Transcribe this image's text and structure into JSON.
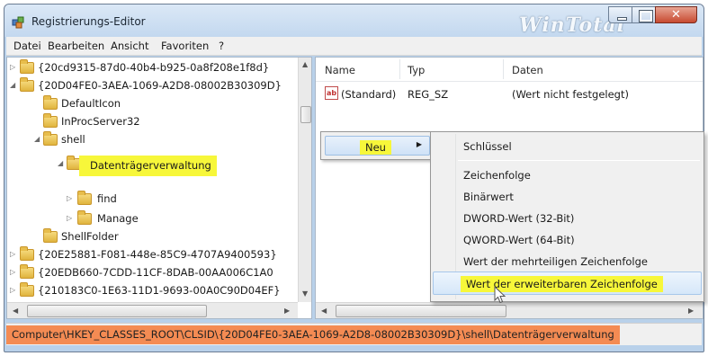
{
  "window": {
    "title": "Registrierungs-Editor",
    "watermark": "WinTotal"
  },
  "menu": [
    "Datei",
    "Bearbeiten",
    "Ansicht",
    "Favoriten",
    "?"
  ],
  "tree": [
    {
      "label": "{20cd9315-87d0-40b4-b925-0a8f208e1f8d}",
      "expander": "▷"
    },
    {
      "label": "{20D04FE0-3AEA-1069-A2D8-08002B30309D}",
      "expander": "◢"
    },
    {
      "label": "DefaultIcon",
      "expander": ""
    },
    {
      "label": "InProcServer32",
      "expander": ""
    },
    {
      "label": "shell",
      "expander": "◢"
    },
    {
      "label": "Datenträgerverwaltung",
      "expander": "◢",
      "highlighted": true
    },
    {
      "label": "find",
      "expander": "▷"
    },
    {
      "label": "Manage",
      "expander": "▷"
    },
    {
      "label": "ShellFolder",
      "expander": ""
    },
    {
      "label": "{20E25881-F081-448e-85C9-4707A9400593}",
      "expander": "▷"
    },
    {
      "label": "{20EDB660-7CDD-11CF-8DAB-00AA006C1A0",
      "expander": "▷"
    },
    {
      "label": "{210183C0-1E63-11D1-9693-00A0C90D04EF}",
      "expander": "▷"
    }
  ],
  "list": {
    "columns": [
      "Name",
      "Typ",
      "Daten"
    ],
    "rows": [
      {
        "name": "(Standard)",
        "type": "REG_SZ",
        "data": "(Wert nicht festgelegt)",
        "icon": "ab"
      }
    ]
  },
  "context_menu": {
    "new_label": "Neu",
    "submenu": [
      "Schlüssel",
      "Zeichenfolge",
      "Binärwert",
      "DWORD-Wert (32-Bit)",
      "QWORD-Wert (64-Bit)",
      "Wert der mehrteiligen Zeichenfolge",
      "Wert der erweiterbaren Zeichenfolge"
    ]
  },
  "status": {
    "path": "Computer\\HKEY_CLASSES_ROOT\\CLSID\\{20D04FE0-3AEA-1069-A2D8-08002B30309D}\\shell\\Datenträgerverwaltung"
  },
  "colors": {
    "highlight": "#f7f73a",
    "status_bg": "#f48b53",
    "close_button": "#c74a30"
  }
}
